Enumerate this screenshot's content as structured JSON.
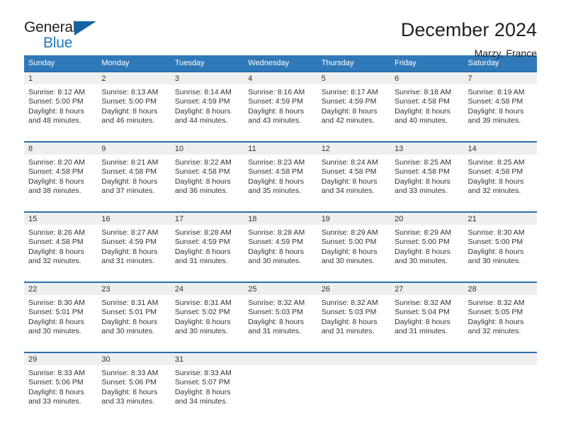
{
  "brand": {
    "name_part1": "General",
    "name_part2": "Blue",
    "triangle_color": "#1464a5",
    "blue_text_color": "#1f77c4"
  },
  "header": {
    "title": "December 2024",
    "subtitle": "Marzy, France"
  },
  "theme": {
    "header_row_background": "#3079b8",
    "header_row_text": "#ffffff",
    "daynum_strip_background": "#efefef",
    "row_top_border": "#2a6fb0",
    "body_text": "#333333"
  },
  "weekday_headers": [
    "Sunday",
    "Monday",
    "Tuesday",
    "Wednesday",
    "Thursday",
    "Friday",
    "Saturday"
  ],
  "labels": {
    "sunrise_prefix": "Sunrise:",
    "sunset_prefix": "Sunset:",
    "daylight_prefix": "Daylight:"
  },
  "weeks": [
    [
      {
        "day": "1",
        "sunrise": "Sunrise: 8:12 AM",
        "sunset": "Sunset: 5:00 PM",
        "daylight_line1": "Daylight: 8 hours",
        "daylight_line2": "and 48 minutes."
      },
      {
        "day": "2",
        "sunrise": "Sunrise: 8:13 AM",
        "sunset": "Sunset: 5:00 PM",
        "daylight_line1": "Daylight: 8 hours",
        "daylight_line2": "and 46 minutes."
      },
      {
        "day": "3",
        "sunrise": "Sunrise: 8:14 AM",
        "sunset": "Sunset: 4:59 PM",
        "daylight_line1": "Daylight: 8 hours",
        "daylight_line2": "and 44 minutes."
      },
      {
        "day": "4",
        "sunrise": "Sunrise: 8:16 AM",
        "sunset": "Sunset: 4:59 PM",
        "daylight_line1": "Daylight: 8 hours",
        "daylight_line2": "and 43 minutes."
      },
      {
        "day": "5",
        "sunrise": "Sunrise: 8:17 AM",
        "sunset": "Sunset: 4:59 PM",
        "daylight_line1": "Daylight: 8 hours",
        "daylight_line2": "and 42 minutes."
      },
      {
        "day": "6",
        "sunrise": "Sunrise: 8:18 AM",
        "sunset": "Sunset: 4:58 PM",
        "daylight_line1": "Daylight: 8 hours",
        "daylight_line2": "and 40 minutes."
      },
      {
        "day": "7",
        "sunrise": "Sunrise: 8:19 AM",
        "sunset": "Sunset: 4:58 PM",
        "daylight_line1": "Daylight: 8 hours",
        "daylight_line2": "and 39 minutes."
      }
    ],
    [
      {
        "day": "8",
        "sunrise": "Sunrise: 8:20 AM",
        "sunset": "Sunset: 4:58 PM",
        "daylight_line1": "Daylight: 8 hours",
        "daylight_line2": "and 38 minutes."
      },
      {
        "day": "9",
        "sunrise": "Sunrise: 8:21 AM",
        "sunset": "Sunset: 4:58 PM",
        "daylight_line1": "Daylight: 8 hours",
        "daylight_line2": "and 37 minutes."
      },
      {
        "day": "10",
        "sunrise": "Sunrise: 8:22 AM",
        "sunset": "Sunset: 4:58 PM",
        "daylight_line1": "Daylight: 8 hours",
        "daylight_line2": "and 36 minutes."
      },
      {
        "day": "11",
        "sunrise": "Sunrise: 8:23 AM",
        "sunset": "Sunset: 4:58 PM",
        "daylight_line1": "Daylight: 8 hours",
        "daylight_line2": "and 35 minutes."
      },
      {
        "day": "12",
        "sunrise": "Sunrise: 8:24 AM",
        "sunset": "Sunset: 4:58 PM",
        "daylight_line1": "Daylight: 8 hours",
        "daylight_line2": "and 34 minutes."
      },
      {
        "day": "13",
        "sunrise": "Sunrise: 8:25 AM",
        "sunset": "Sunset: 4:58 PM",
        "daylight_line1": "Daylight: 8 hours",
        "daylight_line2": "and 33 minutes."
      },
      {
        "day": "14",
        "sunrise": "Sunrise: 8:25 AM",
        "sunset": "Sunset: 4:58 PM",
        "daylight_line1": "Daylight: 8 hours",
        "daylight_line2": "and 32 minutes."
      }
    ],
    [
      {
        "day": "15",
        "sunrise": "Sunrise: 8:26 AM",
        "sunset": "Sunset: 4:58 PM",
        "daylight_line1": "Daylight: 8 hours",
        "daylight_line2": "and 32 minutes."
      },
      {
        "day": "16",
        "sunrise": "Sunrise: 8:27 AM",
        "sunset": "Sunset: 4:59 PM",
        "daylight_line1": "Daylight: 8 hours",
        "daylight_line2": "and 31 minutes."
      },
      {
        "day": "17",
        "sunrise": "Sunrise: 8:28 AM",
        "sunset": "Sunset: 4:59 PM",
        "daylight_line1": "Daylight: 8 hours",
        "daylight_line2": "and 31 minutes."
      },
      {
        "day": "18",
        "sunrise": "Sunrise: 8:28 AM",
        "sunset": "Sunset: 4:59 PM",
        "daylight_line1": "Daylight: 8 hours",
        "daylight_line2": "and 30 minutes."
      },
      {
        "day": "19",
        "sunrise": "Sunrise: 8:29 AM",
        "sunset": "Sunset: 5:00 PM",
        "daylight_line1": "Daylight: 8 hours",
        "daylight_line2": "and 30 minutes."
      },
      {
        "day": "20",
        "sunrise": "Sunrise: 8:29 AM",
        "sunset": "Sunset: 5:00 PM",
        "daylight_line1": "Daylight: 8 hours",
        "daylight_line2": "and 30 minutes."
      },
      {
        "day": "21",
        "sunrise": "Sunrise: 8:30 AM",
        "sunset": "Sunset: 5:00 PM",
        "daylight_line1": "Daylight: 8 hours",
        "daylight_line2": "and 30 minutes."
      }
    ],
    [
      {
        "day": "22",
        "sunrise": "Sunrise: 8:30 AM",
        "sunset": "Sunset: 5:01 PM",
        "daylight_line1": "Daylight: 8 hours",
        "daylight_line2": "and 30 minutes."
      },
      {
        "day": "23",
        "sunrise": "Sunrise: 8:31 AM",
        "sunset": "Sunset: 5:01 PM",
        "daylight_line1": "Daylight: 8 hours",
        "daylight_line2": "and 30 minutes."
      },
      {
        "day": "24",
        "sunrise": "Sunrise: 8:31 AM",
        "sunset": "Sunset: 5:02 PM",
        "daylight_line1": "Daylight: 8 hours",
        "daylight_line2": "and 30 minutes."
      },
      {
        "day": "25",
        "sunrise": "Sunrise: 8:32 AM",
        "sunset": "Sunset: 5:03 PM",
        "daylight_line1": "Daylight: 8 hours",
        "daylight_line2": "and 31 minutes."
      },
      {
        "day": "26",
        "sunrise": "Sunrise: 8:32 AM",
        "sunset": "Sunset: 5:03 PM",
        "daylight_line1": "Daylight: 8 hours",
        "daylight_line2": "and 31 minutes."
      },
      {
        "day": "27",
        "sunrise": "Sunrise: 8:32 AM",
        "sunset": "Sunset: 5:04 PM",
        "daylight_line1": "Daylight: 8 hours",
        "daylight_line2": "and 31 minutes."
      },
      {
        "day": "28",
        "sunrise": "Sunrise: 8:32 AM",
        "sunset": "Sunset: 5:05 PM",
        "daylight_line1": "Daylight: 8 hours",
        "daylight_line2": "and 32 minutes."
      }
    ],
    [
      {
        "day": "29",
        "sunrise": "Sunrise: 8:33 AM",
        "sunset": "Sunset: 5:06 PM",
        "daylight_line1": "Daylight: 8 hours",
        "daylight_line2": "and 33 minutes."
      },
      {
        "day": "30",
        "sunrise": "Sunrise: 8:33 AM",
        "sunset": "Sunset: 5:06 PM",
        "daylight_line1": "Daylight: 8 hours",
        "daylight_line2": "and 33 minutes."
      },
      {
        "day": "31",
        "sunrise": "Sunrise: 8:33 AM",
        "sunset": "Sunset: 5:07 PM",
        "daylight_line1": "Daylight: 8 hours",
        "daylight_line2": "and 34 minutes."
      },
      {
        "day": "",
        "sunrise": "",
        "sunset": "",
        "daylight_line1": "",
        "daylight_line2": ""
      },
      {
        "day": "",
        "sunrise": "",
        "sunset": "",
        "daylight_line1": "",
        "daylight_line2": ""
      },
      {
        "day": "",
        "sunrise": "",
        "sunset": "",
        "daylight_line1": "",
        "daylight_line2": ""
      },
      {
        "day": "",
        "sunrise": "",
        "sunset": "",
        "daylight_line1": "",
        "daylight_line2": ""
      }
    ]
  ]
}
